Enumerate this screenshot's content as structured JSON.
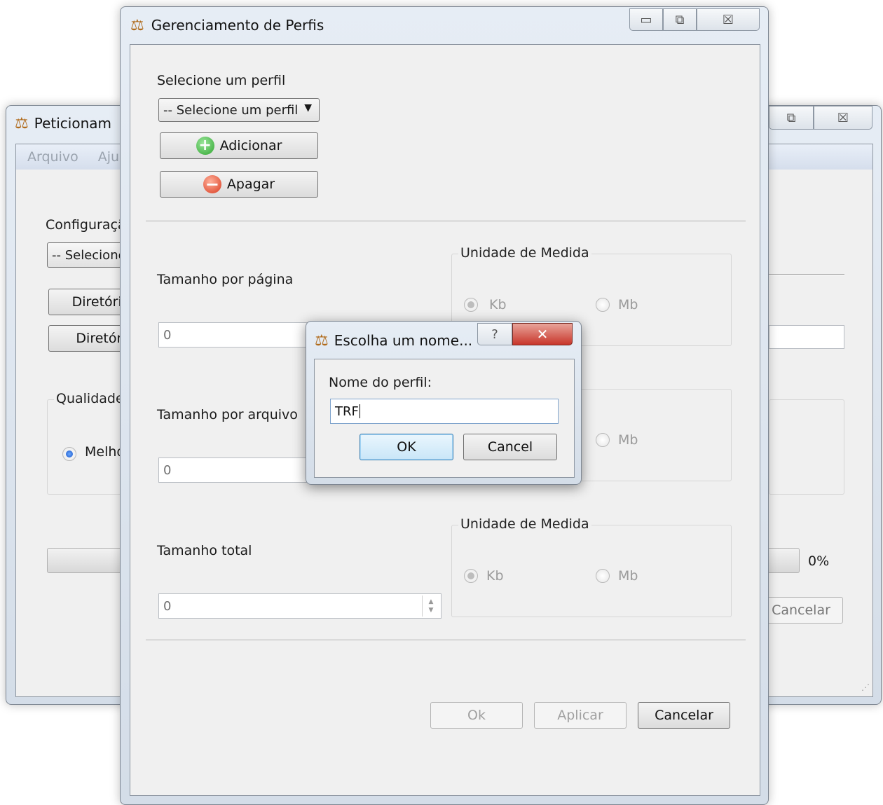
{
  "back_window": {
    "title": "Peticionam",
    "menu": [
      "Arquivo",
      "Aju"
    ],
    "config_label": "Configuraçã",
    "combo": "-- Selecione",
    "buttons": [
      "Diretório",
      "Diretóri"
    ],
    "quality_group": "Qualidade",
    "quality_radio": "Melho",
    "progress": "0%",
    "cancel": "Cancelar"
  },
  "main_window": {
    "title": "Gerenciamento de Perfis",
    "select_label": "Selecione um perfil",
    "select_value": "-- Selecione um perfil",
    "add_button": "Adicionar",
    "delete_button": "Apagar",
    "sections": [
      {
        "label": "Tamanho por página",
        "value": "0",
        "group": "Unidade de Medida",
        "kb": "Kb",
        "mb": "Mb"
      },
      {
        "label": "Tamanho por arquivo",
        "value": "0",
        "group": "",
        "kb": "",
        "mb": "Mb"
      },
      {
        "label": "Tamanho total",
        "value": "0",
        "group": "Unidade de Medida",
        "kb": "Kb",
        "mb": "Mb"
      }
    ],
    "ok_button": "Ok",
    "apply_button": "Aplicar",
    "cancel_button": "Cancelar"
  },
  "dialog": {
    "title": "Escolha um nome...",
    "help": "?",
    "close": "✕",
    "label": "Nome do perfil:",
    "value": "TRF",
    "ok": "OK",
    "cancel": "Cancel"
  },
  "icons": {
    "window": "scale-icon",
    "add": "plus-circle-icon",
    "delete": "minus-circle-icon"
  },
  "colors": {
    "accent": "#1a56c8",
    "add_green": "#2fa52f",
    "delete_red": "#d93a1f",
    "close_red": "#c8352a"
  }
}
